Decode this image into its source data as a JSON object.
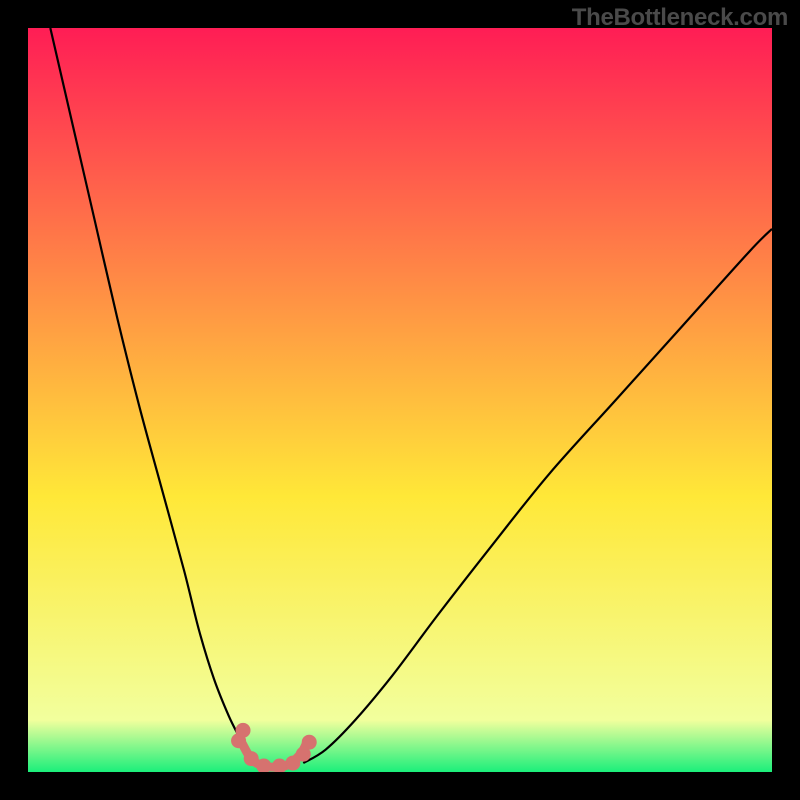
{
  "watermark": "TheBottleneck.com",
  "chart_data": {
    "type": "line",
    "title": "",
    "xlabel": "",
    "ylabel": "",
    "xlim": [
      0,
      100
    ],
    "ylim": [
      0,
      100
    ],
    "background_gradient": {
      "top_color": "#ff1d55",
      "mid_color": "#ffe838",
      "bottom_color": "#1bef7b"
    },
    "series": [
      {
        "name": "left-curve",
        "stroke": "#000000",
        "x": [
          3,
          6,
          9,
          12,
          15,
          18,
          21,
          23,
          25,
          27,
          28.5,
          29.5,
          30.5
        ],
        "y": [
          100,
          87,
          74,
          61,
          49,
          38,
          27,
          19,
          12.5,
          7.5,
          4.5,
          2.5,
          1.2
        ]
      },
      {
        "name": "right-curve",
        "stroke": "#000000",
        "x": [
          37,
          40,
          44,
          49,
          55,
          62,
          70,
          79,
          88,
          97,
          100
        ],
        "y": [
          1.2,
          3,
          7,
          13,
          21,
          30,
          40,
          50,
          60,
          70,
          73
        ]
      },
      {
        "name": "floor-highlight",
        "stroke": "#d6726f",
        "x": [
          28.5,
          29.7,
          30.7,
          32.3,
          34.0,
          35.3,
          36.7,
          37.5
        ],
        "y": [
          4.4,
          2.2,
          1.2,
          0.7,
          0.7,
          1.2,
          2.5,
          4.0
        ]
      }
    ],
    "floor_dot_groups": [
      {
        "cx_frac": 0.283,
        "cy_frac": 0.042
      },
      {
        "cx_frac": 0.289,
        "cy_frac": 0.056
      },
      {
        "cx_frac": 0.3,
        "cy_frac": 0.018
      },
      {
        "cx_frac": 0.317,
        "cy_frac": 0.008
      },
      {
        "cx_frac": 0.338,
        "cy_frac": 0.008
      },
      {
        "cx_frac": 0.356,
        "cy_frac": 0.012
      },
      {
        "cx_frac": 0.37,
        "cy_frac": 0.024
      },
      {
        "cx_frac": 0.378,
        "cy_frac": 0.04
      }
    ]
  }
}
